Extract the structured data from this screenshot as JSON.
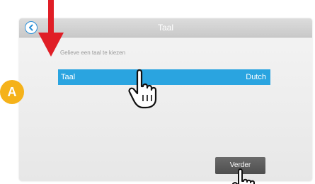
{
  "header": {
    "title": "Taal"
  },
  "prompt": "Gelieve een taal te kiezen",
  "language_row": {
    "label": "Taal",
    "value": "Dutch"
  },
  "footer": {
    "next_label": "Verder"
  },
  "callout": {
    "badge": "A"
  },
  "colors": {
    "accent": "#2aa4e0",
    "badge": "#f5b21a",
    "arrow": "#e01e26",
    "button": "#555555"
  },
  "icons": {
    "back": "chevron-left-icon",
    "pointer": "hand-pointer-icon",
    "arrow": "arrow-down-icon"
  }
}
